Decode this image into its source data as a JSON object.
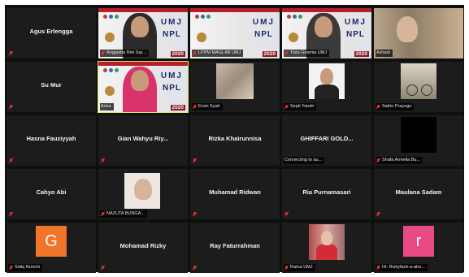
{
  "tiles": [
    {
      "row": 0,
      "col": 0,
      "kind": "name",
      "name": "Agus Erlengga",
      "muted": true
    },
    {
      "row": 0,
      "col": 1,
      "kind": "banner",
      "label": "Anggiatta Rini Sar...",
      "year": "2020",
      "muted": true,
      "person_color": "#2b2b2b"
    },
    {
      "row": 0,
      "col": 2,
      "kind": "banner",
      "label": "LPPM MAGLAB UMJ",
      "year": "2020",
      "muted": true,
      "person_color": null
    },
    {
      "row": 0,
      "col": 3,
      "kind": "banner",
      "label": "Tista Gosmia UMJ",
      "year": "2020",
      "muted": true,
      "person_color": "#3a3a3a"
    },
    {
      "row": 0,
      "col": 4,
      "kind": "photo",
      "label": "Ashadi",
      "muted": false,
      "photo": "man-bookshelf"
    },
    {
      "row": 1,
      "col": 0,
      "kind": "name",
      "name": "Su Mur",
      "muted": true
    },
    {
      "row": 1,
      "col": 1,
      "kind": "banner",
      "label": "Arisa",
      "year": "2020",
      "muted": false,
      "active": true,
      "person_color": "#d8346b"
    },
    {
      "row": 1,
      "col": 2,
      "kind": "photo",
      "label": "Ervin Syah",
      "muted": true,
      "photo": "sand"
    },
    {
      "row": 1,
      "col": 3,
      "kind": "photo",
      "label": "Septi Yandri",
      "muted": true,
      "photo": "portrait"
    },
    {
      "row": 1,
      "col": 4,
      "kind": "photo",
      "label": "Satrio Prayogo",
      "muted": true,
      "photo": "bike"
    },
    {
      "row": 2,
      "col": 0,
      "kind": "name",
      "name": "Hasna Fauziyyah",
      "muted": true
    },
    {
      "row": 2,
      "col": 1,
      "kind": "name",
      "name": "Gian Wahyu Riy...",
      "muted": true
    },
    {
      "row": 2,
      "col": 2,
      "kind": "name",
      "name": "Rizka Khairunnisa",
      "muted": true
    },
    {
      "row": 2,
      "col": 3,
      "kind": "name",
      "name": "GHIFFARI GOLD...",
      "muted": false,
      "label": "Connecting to au..."
    },
    {
      "row": 2,
      "col": 4,
      "kind": "photo",
      "label": "Shafa Armelia Bu...",
      "muted": true,
      "photo": "black"
    },
    {
      "row": 3,
      "col": 0,
      "kind": "name",
      "name": "Cahyo Abi",
      "muted": true
    },
    {
      "row": 3,
      "col": 1,
      "kind": "photo",
      "label": "NAZUTA BUNGA...",
      "muted": true,
      "photo": "glasses"
    },
    {
      "row": 3,
      "col": 2,
      "kind": "name",
      "name": "Muhamad Ridwan",
      "muted": true
    },
    {
      "row": 3,
      "col": 3,
      "kind": "name",
      "name": "Ria Purnamasari",
      "muted": true
    },
    {
      "row": 3,
      "col": 4,
      "kind": "name",
      "name": "Maulana Sadam",
      "muted": true
    },
    {
      "row": 4,
      "col": 0,
      "kind": "letter",
      "label": "Sidiq Nurichi",
      "letter": "G",
      "color": "#f0742a",
      "muted": true
    },
    {
      "row": 4,
      "col": 1,
      "kind": "name",
      "name": "Mohamad Rizky",
      "muted": true
    },
    {
      "row": 4,
      "col": 2,
      "kind": "name",
      "name": "Ray Faturrahman",
      "muted": true
    },
    {
      "row": 4,
      "col": 3,
      "kind": "photo",
      "label": "Rama UMJ",
      "muted": true,
      "photo": "red-shelf"
    },
    {
      "row": 4,
      "col": 4,
      "kind": "letter",
      "label": "Hi- Rizkyfach-a-ahe...",
      "letter": "r",
      "color": "#e84a83",
      "muted": true
    }
  ],
  "banner": {
    "title": "UMJ",
    "subtitle": "NPL"
  },
  "colors": {
    "muted_mic": "#e0312b",
    "active_border": "#e3e35c",
    "grid_bg": "#0f0f0f",
    "tile_bg": "#1c1c1c"
  }
}
